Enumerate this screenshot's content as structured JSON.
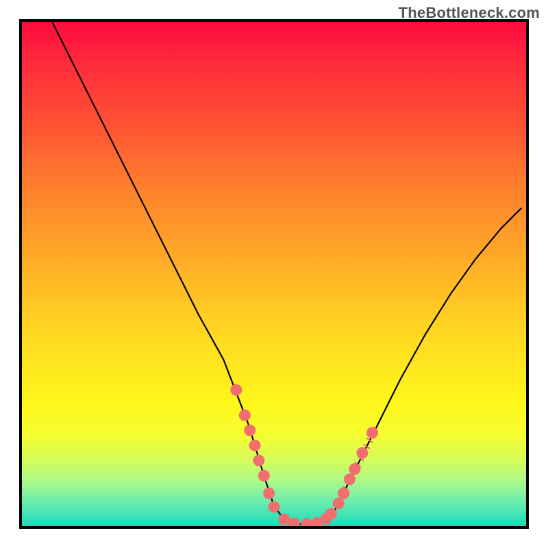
{
  "watermark": "TheBottleneck.com",
  "chart_data": {
    "type": "line",
    "title": "",
    "xlabel": "",
    "ylabel": "",
    "xlim": [
      0,
      100
    ],
    "ylim": [
      0,
      100
    ],
    "series": [
      {
        "name": "curve",
        "x": [
          6,
          10,
          15,
          20,
          25,
          30,
          35,
          40,
          45,
          48,
          50,
          52,
          55,
          58,
          60,
          62,
          65,
          70,
          75,
          80,
          85,
          90,
          95,
          99
        ],
        "y": [
          100,
          92,
          82,
          72,
          62,
          52,
          42,
          33,
          20,
          10,
          4,
          1.3,
          0.4,
          0.4,
          1.1,
          3,
          9,
          19,
          29,
          38,
          46,
          53,
          59,
          63
        ]
      }
    ],
    "markers": {
      "name": "highlighted-points",
      "color": "#f26d6d",
      "points": [
        {
          "x": 42.5,
          "y": 27
        },
        {
          "x": 44.2,
          "y": 22
        },
        {
          "x": 45.2,
          "y": 19
        },
        {
          "x": 46.2,
          "y": 16
        },
        {
          "x": 47.0,
          "y": 13
        },
        {
          "x": 48.0,
          "y": 10
        },
        {
          "x": 49.0,
          "y": 6.5
        },
        {
          "x": 50.0,
          "y": 3.8
        },
        {
          "x": 52.0,
          "y": 1.3
        },
        {
          "x": 54.0,
          "y": 0.5
        },
        {
          "x": 56.5,
          "y": 0.4
        },
        {
          "x": 58.5,
          "y": 0.6
        },
        {
          "x": 60.3,
          "y": 1.4
        },
        {
          "x": 61.3,
          "y": 2.4
        },
        {
          "x": 62.8,
          "y": 4.5
        },
        {
          "x": 63.8,
          "y": 6.5
        },
        {
          "x": 65.0,
          "y": 9.3
        },
        {
          "x": 66.0,
          "y": 11.3
        },
        {
          "x": 67.5,
          "y": 14.5
        },
        {
          "x": 69.5,
          "y": 18.5
        }
      ]
    },
    "gradient_stops": [
      {
        "pos": 0,
        "color": "#ff0b3e"
      },
      {
        "pos": 50,
        "color": "#ffcd23"
      },
      {
        "pos": 80,
        "color": "#fff81c"
      },
      {
        "pos": 100,
        "color": "#1fd9bb"
      }
    ]
  }
}
